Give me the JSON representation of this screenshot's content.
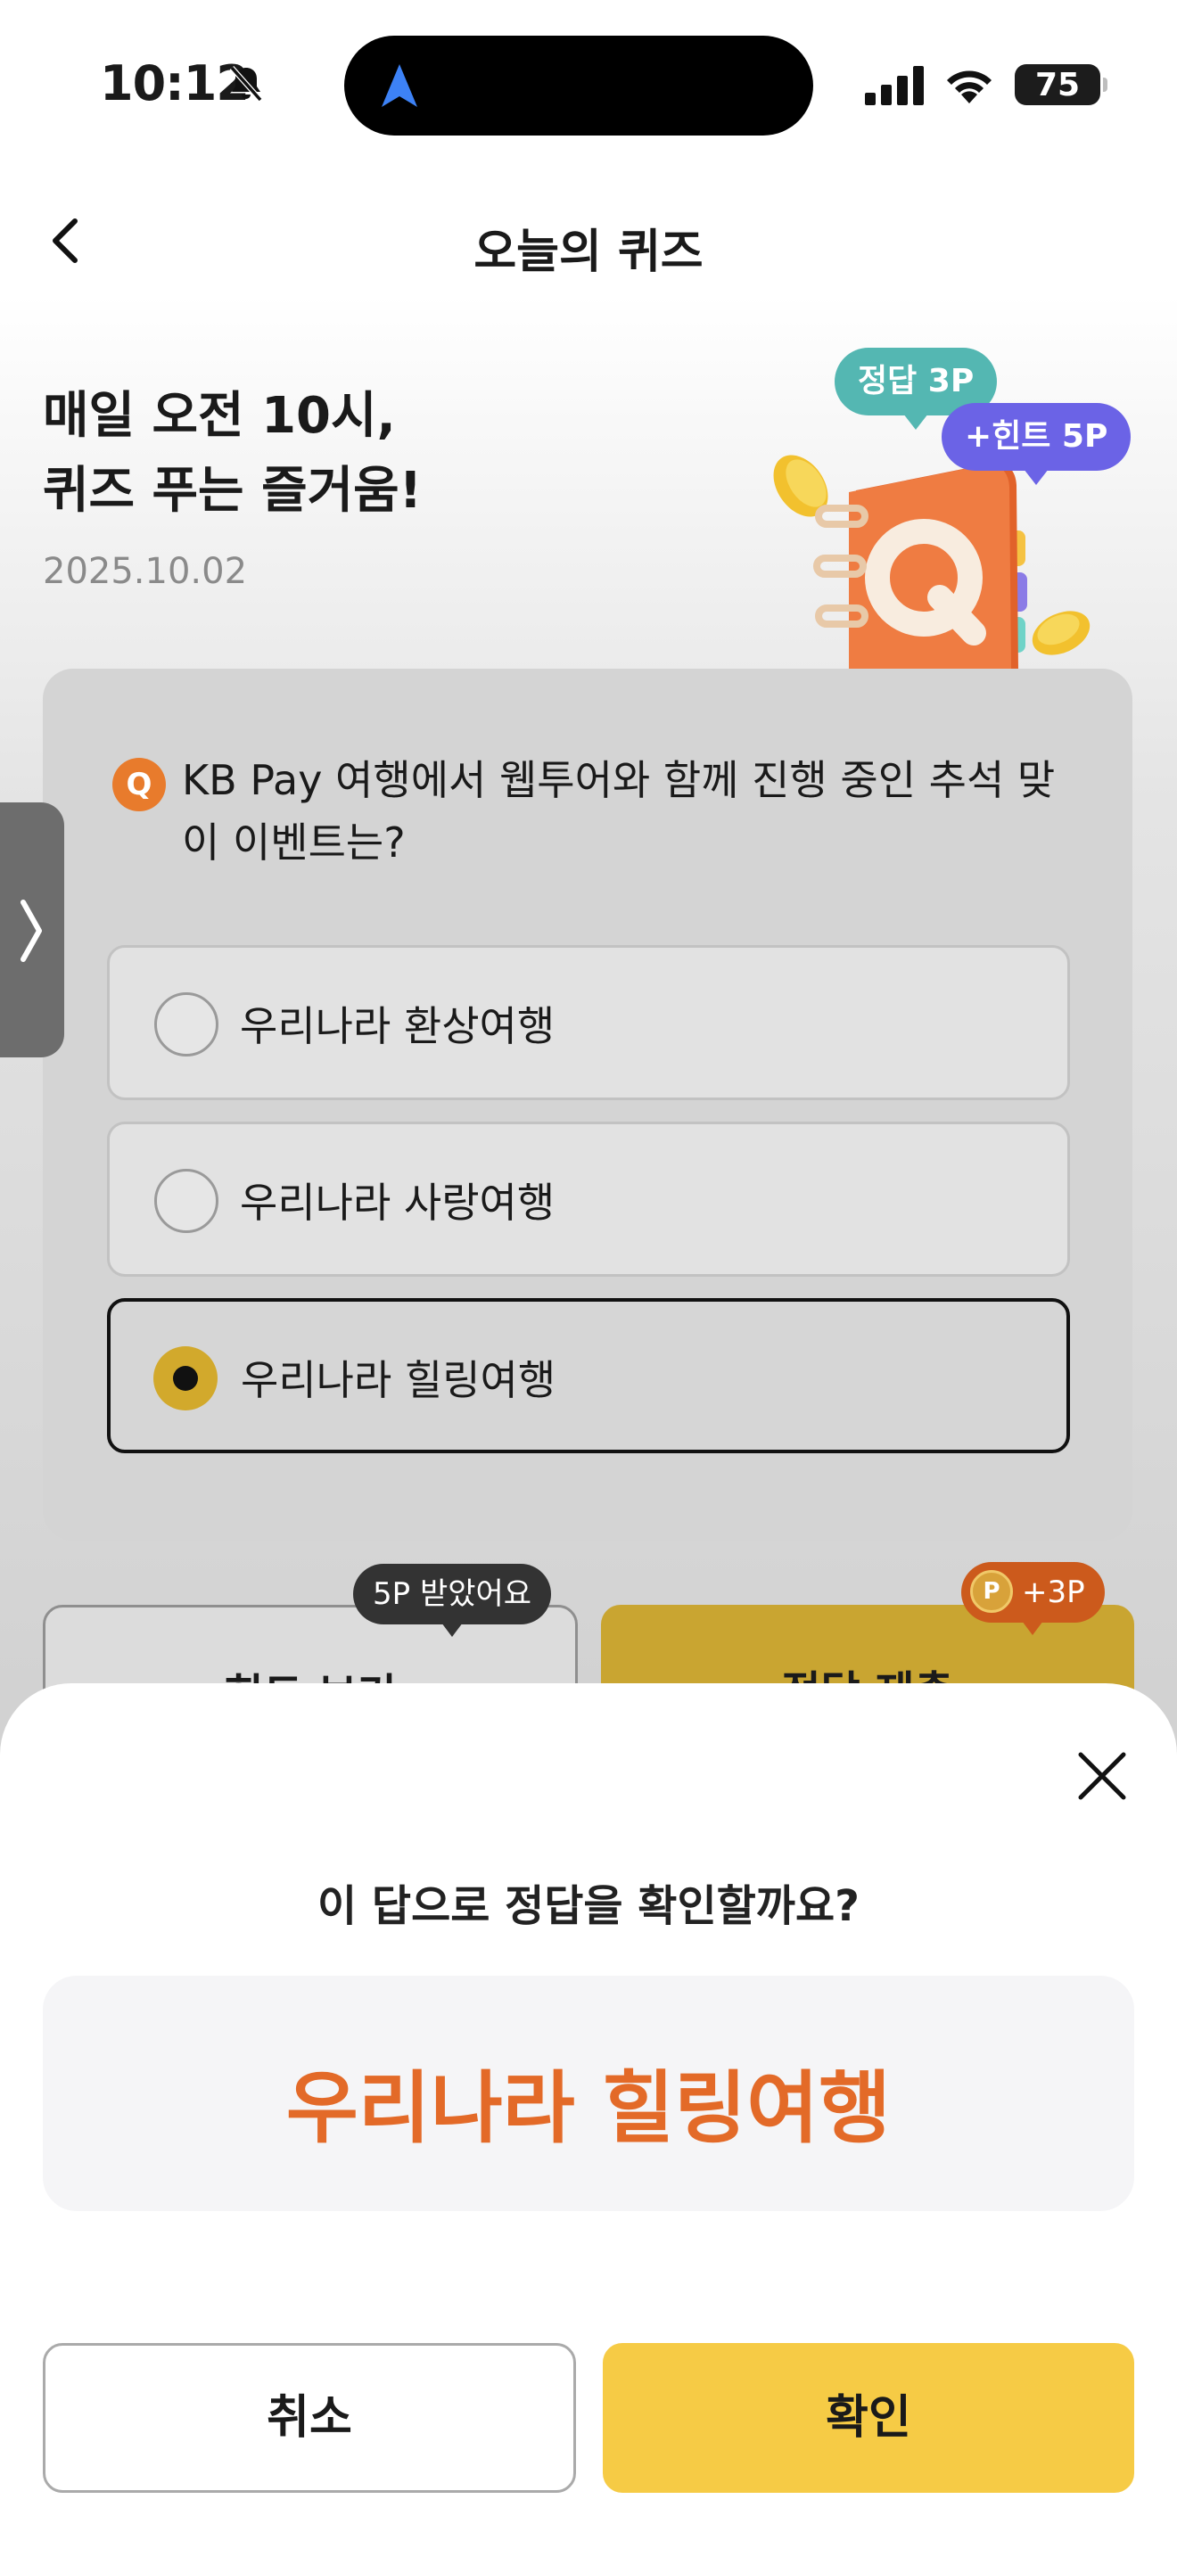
{
  "status_bar": {
    "time": "10:12",
    "battery": "75"
  },
  "header": {
    "title": "오늘의 퀴즈"
  },
  "hero": {
    "title": "매일 오전 10시,\n퀴즈 푸는 즐거움!",
    "date": "2025.10.02",
    "badge_answer": "정답 3P",
    "badge_hint": "+힌트 5P",
    "illustration_letter": "Q"
  },
  "quiz": {
    "badge": "Q",
    "question": "KB Pay 여행에서 웹투어와 함께 진행 중인 추석 맞이 이벤트는?",
    "options": [
      {
        "label": "우리나라 환상여행",
        "selected": false
      },
      {
        "label": "우리나라 사랑여행",
        "selected": false
      },
      {
        "label": "우리나라 힐링여행",
        "selected": true
      }
    ]
  },
  "actions": {
    "hint_label": "힌트 보기",
    "hint_tip": "5P 받았어요",
    "submit_label": "정답 제출",
    "submit_tip": "+3P",
    "point_coin": "P"
  },
  "sheet": {
    "question": "이 답으로 정답을 확인할까요?",
    "answer": "우리나라 힐링여행",
    "cancel_label": "취소",
    "confirm_label": "확인"
  },
  "colors": {
    "accent_orange": "#e36a28",
    "accent_yellow": "#f6cb45",
    "badge_teal": "#54b7b2",
    "badge_purple": "#6b63e6"
  }
}
